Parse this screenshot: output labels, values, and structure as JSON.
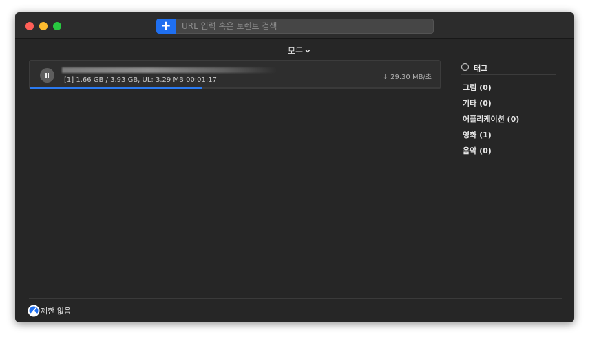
{
  "search": {
    "add_label": "+",
    "placeholder": "URL 입력 혹은 토렌트 검색"
  },
  "filter": {
    "label": "모두"
  },
  "torrent": {
    "stats": "[1] 1.66 GB / 3.93 GB, UL: 3.29 MB 00:01:17",
    "speed": "↓ 29.30 MB/초",
    "progress_fraction": 0.42
  },
  "tags": {
    "title": "태그",
    "items": [
      {
        "label": "그림 (0)"
      },
      {
        "label": "기타 (0)"
      },
      {
        "label": "어플리케이션 (0)"
      },
      {
        "label": "영화 (1)"
      },
      {
        "label": "음악 (0)"
      }
    ]
  },
  "footer": {
    "limit_label": "제한 없음"
  },
  "colors": {
    "accent": "#1f6ff0",
    "progress": "#2b7af0",
    "close": "#ff5f57",
    "minimize": "#febc2e",
    "maximize": "#28c840"
  }
}
